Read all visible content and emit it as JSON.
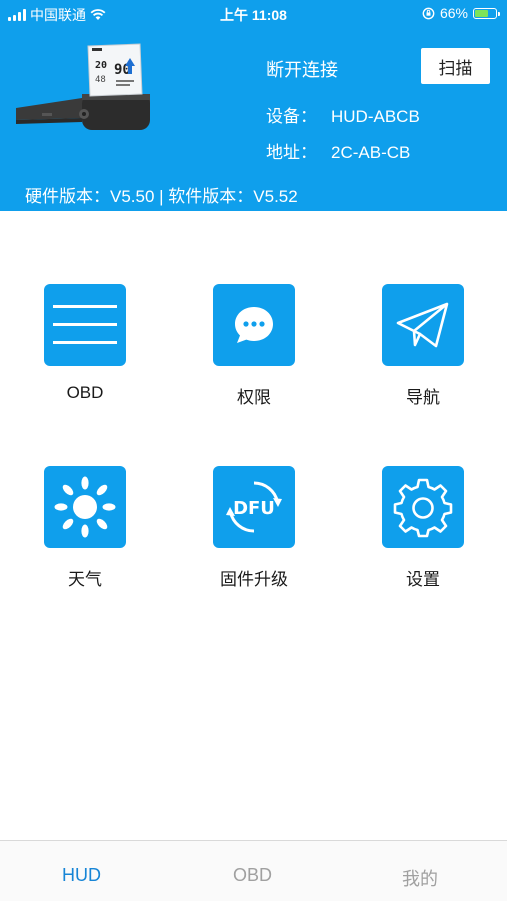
{
  "status_bar": {
    "carrier": "中国联通",
    "time": "上午 11:08",
    "battery_percent": "66%",
    "battery_level": 0.66
  },
  "header": {
    "disconnect_label": "断开连接",
    "scan_label": "扫描",
    "device_label": "设备：",
    "device_value": "HUD-ABCB",
    "address_label": "地址：",
    "address_value": "2C-AB-CB",
    "versions": "硬件版本：V5.50 | 软件版本：V5.52"
  },
  "grid": [
    {
      "label": "OBD",
      "icon": "list-icon"
    },
    {
      "label": "权限",
      "icon": "chat-bubble-icon"
    },
    {
      "label": "导航",
      "icon": "paper-plane-icon"
    },
    {
      "label": "天气",
      "icon": "sun-icon"
    },
    {
      "label": "固件升级",
      "icon": "dfu-icon"
    },
    {
      "label": "设置",
      "icon": "gear-icon"
    }
  ],
  "tabbar": {
    "tabs": [
      {
        "label": "HUD",
        "active": true
      },
      {
        "label": "OBD",
        "active": false
      },
      {
        "label": "我的",
        "active": false
      }
    ]
  },
  "colors": {
    "primary": "#0f9fec",
    "tab_active": "#1785d6",
    "tab_inactive": "#a0a0a0"
  }
}
